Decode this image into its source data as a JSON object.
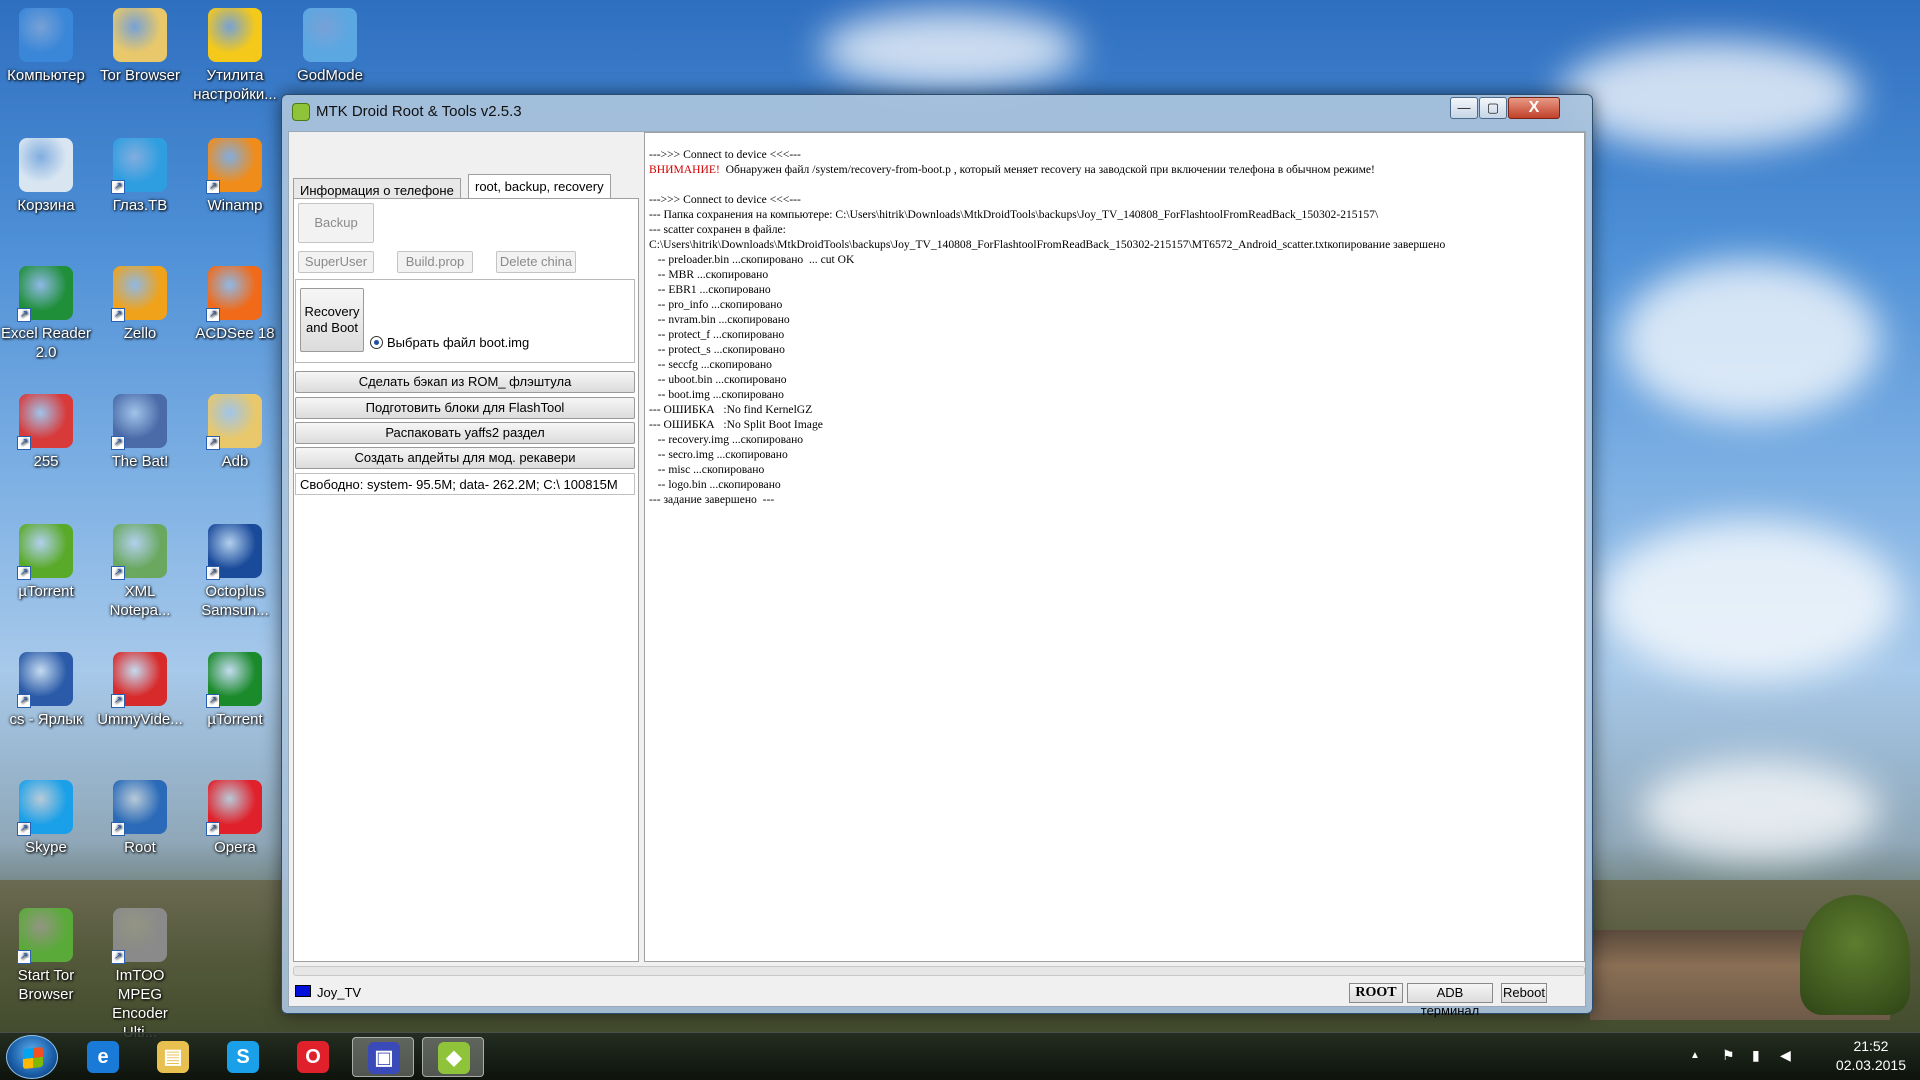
{
  "desktop": {
    "icons": [
      {
        "label": "Компьютер",
        "color": "#3a86d8"
      },
      {
        "label": "Tor Browser",
        "color": "#e8c86a"
      },
      {
        "label": "Утилита настройки...",
        "color": "#f4c91a"
      },
      {
        "label": "GodMode",
        "color": "#5ba7e2"
      },
      {
        "label": "Корзина",
        "color": "#d9e6f2"
      },
      {
        "label": "Глаз.ТВ",
        "color": "#2f9ee0"
      },
      {
        "label": "Winamp",
        "color": "#f08c1a"
      },
      {
        "label": "Excel Reader 2.0",
        "color": "#1f8f3a"
      },
      {
        "label": "Zello",
        "color": "#f0a21a"
      },
      {
        "label": "ACDSee 18",
        "color": "#f06a1a"
      },
      {
        "label": "255",
        "color": "#d83a3a"
      },
      {
        "label": "The Bat!",
        "color": "#4a6aa8"
      },
      {
        "label": "Adb",
        "color": "#e8c86a"
      },
      {
        "label": "µTorrent",
        "color": "#5aaa2a"
      },
      {
        "label": "XML Notepa...",
        "color": "#6aa860"
      },
      {
        "label": "Octoplus Samsun...",
        "color": "#1a4a9a"
      },
      {
        "label": "cs - Ярлык",
        "color": "#2a5aa8"
      },
      {
        "label": "UmmyVide...",
        "color": "#d82a2a"
      },
      {
        "label": "µTorrent",
        "color": "#1a8a2a"
      },
      {
        "label": "Skype",
        "color": "#1aa0e8"
      },
      {
        "label": "Root",
        "color": "#2a6ab8"
      },
      {
        "label": "Opera",
        "color": "#e0202a"
      },
      {
        "label": "Start Tor Browser",
        "color": "#5aaa3a"
      },
      {
        "label": "ImTOO MPEG Encoder Ulti...",
        "color": "#8a8a8a"
      }
    ]
  },
  "window": {
    "title": "MTK Droid Root & Tools v2.5.3",
    "controls": {
      "minimize": "—",
      "maximize": "▢",
      "close": "X"
    },
    "tabs": [
      {
        "label": "Информация о телефоне",
        "active": false
      },
      {
        "label": "root, backup, recovery",
        "active": true
      }
    ],
    "buttons": {
      "backup": "Backup",
      "superuser": "SuperUser",
      "buildprop": "Build.prop",
      "deletechina": "Delete china",
      "recovery_line1": "Recovery",
      "recovery_line2": "and Boot",
      "radio_bootimg": "Выбрать файл boot.img",
      "rom_backup": "Сделать бэкап из ROM_ флэштула",
      "prepare_blocks": "Подготовить блоки для FlashTool",
      "unpack_yaffs": "Распаковать yaffs2 раздел",
      "create_updates": "Создать апдейты для мод. рекавери"
    },
    "free_space": "Свободно: system- 95.5M; data- 262.2M;  C:\\ 100815M",
    "log": {
      "line1": "--->>> Connect to device <<<---",
      "warn_label": "ВНИМАНИЕ!",
      "warn_text": "  Обнаружен файл /system/recovery-from-boot.p , который меняет recovery на заводской при включении телефона в обычном режиме!",
      "body": "\n--->>> Connect to device <<<---\n--- Папка сохранения на компьютере: C:\\Users\\hitrik\\Downloads\\MtkDroidTools\\backups\\Joy_TV_140808_ForFlashtoolFromReadBack_150302-215157\\\n--- scatter сохранен в файле:\nC:\\Users\\hitrik\\Downloads\\MtkDroidTools\\backups\\Joy_TV_140808_ForFlashtoolFromReadBack_150302-215157\\MT6572_Android_scatter.txtкопирование завершено\n   -- preloader.bin ...скопировано  ... cut OK\n   -- MBR ...скопировано\n   -- EBR1 ...скопировано\n   -- pro_info ...скопировано\n   -- nvram.bin ...скопировано\n   -- protect_f ...скопировано\n   -- protect_s ...скопировано\n   -- seccfg ...скопировано\n   -- uboot.bin ...скопировано\n   -- boot.img ...скопировано\n--- ОШИБКА   :No find KernelGZ\n--- ОШИБКА   :No Split Boot Image\n   -- recovery.img ...скопировано\n   -- secro.img ...скопировано\n   -- misc ...скопировано\n   -- logo.bin ...скопировано\n--- задание завершено  ---"
    },
    "status": {
      "device": "Joy_TV",
      "device_color": "#0010d8",
      "root": "ROOT",
      "adb": "ADB терминал",
      "reboot": "Reboot"
    }
  },
  "taskbar": {
    "apps": [
      {
        "name": "internet-explorer",
        "glyph": "e",
        "color": "#1a7ad8",
        "active": false
      },
      {
        "name": "file-explorer",
        "glyph": "▤",
        "color": "#e8c050",
        "active": false
      },
      {
        "name": "skype",
        "glyph": "S",
        "color": "#1aa0e8",
        "active": false
      },
      {
        "name": "opera",
        "glyph": "O",
        "color": "#e0202a",
        "active": false
      },
      {
        "name": "floppy-app",
        "glyph": "▣",
        "color": "#3a4ab8",
        "active": true
      },
      {
        "name": "mtk-droid-tools",
        "glyph": "◆",
        "color": "#8fc43a",
        "active": true
      }
    ],
    "tray": {
      "up": "▲",
      "flag": "⚑",
      "signal": "▮",
      "volume": "◀"
    },
    "time": "21:52",
    "date": "02.03.2015"
  }
}
